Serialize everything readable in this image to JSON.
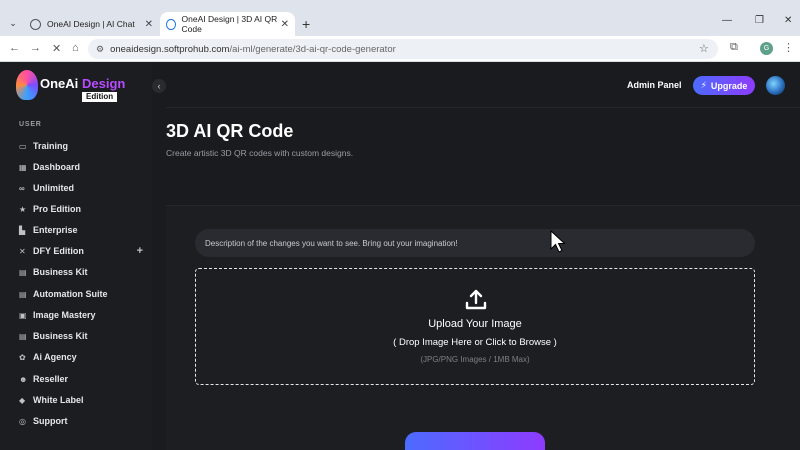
{
  "browser": {
    "tabs": [
      {
        "title": "OneAI Design | AI Chat",
        "active": false
      },
      {
        "title": "OneAI Design | 3D AI QR Code",
        "active": true
      }
    ],
    "url_host": "oneaidesign.softprohub.com",
    "url_path": "/ai-ml/generate/3d-ai-qr-code-generator",
    "profile_initial": "G"
  },
  "logo": {
    "one_ai": "OneAi",
    "design": "Design",
    "edition": "Edition"
  },
  "sidebar": {
    "section": "USER",
    "items": [
      {
        "label": "Training",
        "icon": "chalkboard-icon"
      },
      {
        "label": "Dashboard",
        "icon": "dashboard-icon"
      },
      {
        "label": "Unlimited",
        "icon": "infinity-icon"
      },
      {
        "label": "Pro Edition",
        "icon": "star-icon"
      },
      {
        "label": "Enterprise",
        "icon": "building-icon"
      },
      {
        "label": "DFY Edition",
        "icon": "tools-icon"
      },
      {
        "label": "Business Kit",
        "icon": "grid-icon"
      },
      {
        "label": "Automation Suite",
        "icon": "grid-icon"
      },
      {
        "label": "Image Mastery",
        "icon": "image-icon"
      },
      {
        "label": "Business Kit",
        "icon": "grid-icon"
      },
      {
        "label": "Ai Agency",
        "icon": "agency-icon"
      },
      {
        "label": "Reseller",
        "icon": "user-plus-icon"
      },
      {
        "label": "White Label",
        "icon": "tag-icon"
      },
      {
        "label": "Support",
        "icon": "support-icon"
      }
    ]
  },
  "header": {
    "admin_panel": "Admin Panel",
    "upgrade": "Upgrade"
  },
  "page": {
    "title": "3D AI QR Code",
    "subtitle": "Create artistic 3D QR codes with custom designs."
  },
  "form": {
    "prompt_placeholder": "Description of the changes you want to see. Bring out your imagination!",
    "upload_title": "Upload Your Image",
    "upload_sub": "( Drop Image Here or Click to Browse )",
    "upload_hint": "(JPG/PNG Images / 1MB Max)"
  },
  "colors": {
    "accent_start": "#4c6bff",
    "accent_end": "#8e3bff",
    "background": "#1a1b1f"
  }
}
